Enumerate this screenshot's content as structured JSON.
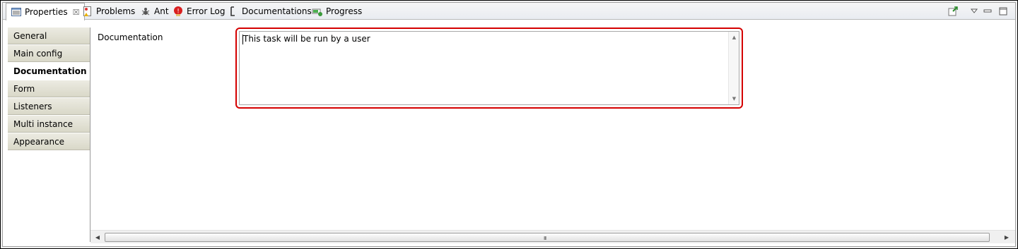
{
  "tabs": [
    {
      "label": "Properties",
      "icon": "properties-icon",
      "active": true
    },
    {
      "label": "Problems",
      "icon": "problems-icon"
    },
    {
      "label": "Ant",
      "icon": "ant-icon"
    },
    {
      "label": "Error Log",
      "icon": "error-log-icon"
    },
    {
      "label": "Documentations",
      "icon": "documentations-icon"
    },
    {
      "label": "Progress",
      "icon": "progress-icon"
    }
  ],
  "close_glyph": "☒",
  "nav": {
    "items": [
      {
        "label": "General"
      },
      {
        "label": "Main config"
      },
      {
        "label": "Documentation",
        "selected": true
      },
      {
        "label": "Form"
      },
      {
        "label": "Listeners"
      },
      {
        "label": "Multi instance"
      },
      {
        "label": "Appearance"
      }
    ]
  },
  "content": {
    "field_label": "Documentation",
    "documentation_value": "This task will be run by a user",
    "highlight_color": "#d40000"
  },
  "scroll": {
    "grip": "III"
  }
}
